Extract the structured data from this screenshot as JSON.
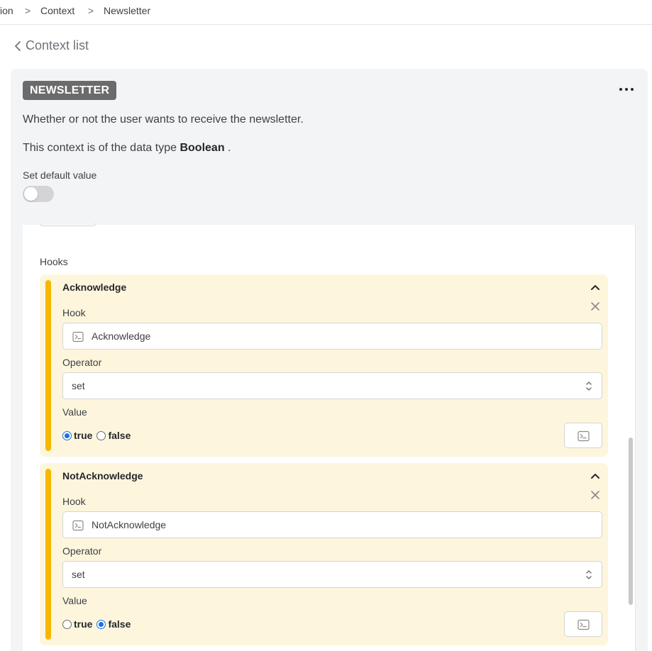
{
  "breadcrumb": {
    "items": [
      "ion",
      "Context",
      "Newsletter"
    ],
    "separator": ">"
  },
  "back_link": {
    "label": "Context list"
  },
  "context": {
    "name": "NEWSLETTER",
    "description": "Whether or not the user wants to receive the newsletter.",
    "datatype_prefix": "This context is of the data type",
    "datatype": "Boolean",
    "datatype_suffix": ".",
    "default_label": "Set default value",
    "default_enabled": false
  },
  "hooks": {
    "title": "Hooks",
    "items": [
      {
        "title": "Acknowledge",
        "hook_label": "Hook",
        "hook_value": "Acknowledge",
        "operator_label": "Operator",
        "operator_value": "set",
        "value_label": "Value",
        "option_true": "true",
        "option_false": "false",
        "selected": "true"
      },
      {
        "title": "NotAcknowledge",
        "hook_label": "Hook",
        "hook_value": "NotAcknowledge",
        "operator_label": "Operator",
        "operator_value": "set",
        "value_label": "Value",
        "option_true": "true",
        "option_false": "false",
        "selected": "false"
      }
    ]
  },
  "colors": {
    "accent_bar": "#f5b800",
    "hook_background": "#fdf6dd",
    "badge": "#6b6b6b",
    "radio_selected": "#1a6fe8"
  },
  "icons": {
    "breadcrumb_separator": "chevron-right-icon",
    "back": "chevron-left-icon",
    "more": "more-horizontal-icon",
    "collapse": "chevron-up-icon",
    "remove": "close-icon",
    "hook_input": "terminal-icon",
    "operator_select": "chevron-up-down-icon",
    "value_editor": "terminal-icon"
  }
}
